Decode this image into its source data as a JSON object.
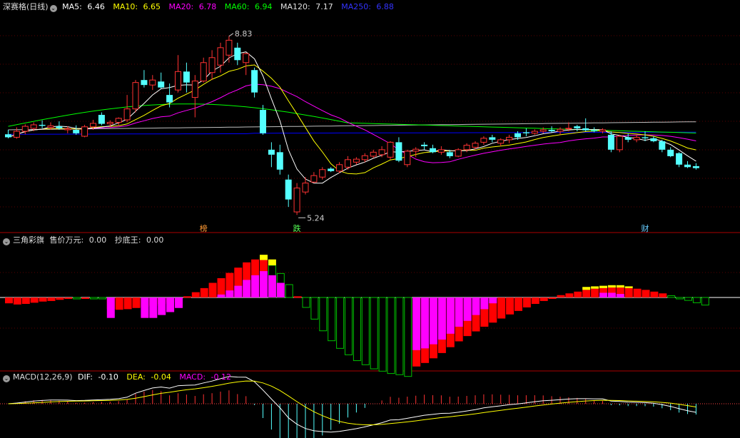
{
  "colors": {
    "up": "#ff3232",
    "down": "#54ffff",
    "ma5": "#ffffff",
    "ma10": "#ffff00",
    "ma20": "#ff00ff",
    "ma60": "#00ff00",
    "ma120": "#c0c0c0",
    "ma250": "#0000ff",
    "magenta": "#ff00ff",
    "yellow": "#ffff00",
    "red": "#ff0000",
    "green": "#00c000",
    "divider": "#aa0000"
  },
  "main_panel": {
    "title": "深赛格(日线)",
    "icon": "chevron-down-icon",
    "ma": [
      {
        "label": "MA5:",
        "value": "6.46"
      },
      {
        "label": "MA10:",
        "value": "6.65"
      },
      {
        "label": "MA20:",
        "value": "6.78"
      },
      {
        "label": "MA60:",
        "value": "6.94"
      },
      {
        "label": "MA120:",
        "value": "7.17"
      },
      {
        "label": "MA250:",
        "value": "6.88"
      }
    ],
    "high_label": "8.83",
    "low_label": "5.24",
    "markers": [
      "榜",
      "跌",
      "财"
    ]
  },
  "sub1_panel": {
    "title": "三角彩旗",
    "legend": [
      {
        "label": "售价万元:",
        "value": "0.00"
      },
      {
        "label": "抄底王:",
        "value": "0.00"
      }
    ]
  },
  "sub2_panel": {
    "title": "MACD(12,26,9)",
    "legend": [
      {
        "label": "DIF:",
        "value": "-0.10"
      },
      {
        "label": "DEA:",
        "value": "-0.04"
      },
      {
        "label": "MACD:",
        "value": "-0.12"
      }
    ]
  },
  "chart_data": [
    {
      "type": "candlestick",
      "title": "深赛格(日线)",
      "ylim": [
        5.0,
        9.3
      ],
      "candles": [
        {
          "o": 6.86,
          "h": 6.95,
          "l": 6.78,
          "c": 6.8
        },
        {
          "o": 6.8,
          "h": 7.0,
          "l": 6.77,
          "c": 6.92
        },
        {
          "o": 6.92,
          "h": 7.06,
          "l": 6.86,
          "c": 7.02
        },
        {
          "o": 6.98,
          "h": 7.1,
          "l": 6.92,
          "c": 7.05
        },
        {
          "o": 7.05,
          "h": 7.14,
          "l": 6.98,
          "c": 7.03
        },
        {
          "o": 7.0,
          "h": 7.1,
          "l": 6.95,
          "c": 7.03
        },
        {
          "o": 7.02,
          "h": 7.12,
          "l": 6.95,
          "c": 6.98
        },
        {
          "o": 6.95,
          "h": 7.02,
          "l": 6.88,
          "c": 6.97
        },
        {
          "o": 6.95,
          "h": 7.04,
          "l": 6.85,
          "c": 6.88
        },
        {
          "o": 6.82,
          "h": 7.05,
          "l": 6.8,
          "c": 7.01
        },
        {
          "o": 7.01,
          "h": 7.15,
          "l": 6.95,
          "c": 7.08
        },
        {
          "o": 7.25,
          "h": 7.3,
          "l": 7.04,
          "c": 7.07
        },
        {
          "o": 7.07,
          "h": 7.14,
          "l": 7.0,
          "c": 7.1
        },
        {
          "o": 7.1,
          "h": 7.2,
          "l": 7.03,
          "c": 7.18
        },
        {
          "o": 7.15,
          "h": 7.65,
          "l": 7.1,
          "c": 7.37
        },
        {
          "o": 7.37,
          "h": 7.95,
          "l": 7.3,
          "c": 7.9
        },
        {
          "o": 7.95,
          "h": 8.15,
          "l": 7.8,
          "c": 7.85
        },
        {
          "o": 7.85,
          "h": 8.05,
          "l": 7.75,
          "c": 7.95
        },
        {
          "o": 7.92,
          "h": 8.1,
          "l": 7.78,
          "c": 7.8
        },
        {
          "o": 7.65,
          "h": 7.88,
          "l": 7.4,
          "c": 7.5
        },
        {
          "o": 7.75,
          "h": 8.45,
          "l": 7.7,
          "c": 8.12
        },
        {
          "o": 8.12,
          "h": 8.3,
          "l": 7.7,
          "c": 7.9
        },
        {
          "o": 7.6,
          "h": 8.05,
          "l": 7.2,
          "c": 7.93
        },
        {
          "o": 7.93,
          "h": 8.4,
          "l": 7.9,
          "c": 8.3
        },
        {
          "o": 8.1,
          "h": 8.55,
          "l": 7.95,
          "c": 8.4
        },
        {
          "o": 8.25,
          "h": 8.7,
          "l": 8.1,
          "c": 8.6
        },
        {
          "o": 8.45,
          "h": 8.83,
          "l": 8.3,
          "c": 8.75
        },
        {
          "o": 8.6,
          "h": 8.7,
          "l": 8.25,
          "c": 8.35
        },
        {
          "o": 8.3,
          "h": 8.5,
          "l": 8.05,
          "c": 8.48
        },
        {
          "o": 8.15,
          "h": 8.2,
          "l": 7.6,
          "c": 7.7
        },
        {
          "o": 7.35,
          "h": 7.45,
          "l": 6.85,
          "c": 6.88
        },
        {
          "o": 6.55,
          "h": 6.7,
          "l": 6.2,
          "c": 6.45
        },
        {
          "o": 6.5,
          "h": 6.65,
          "l": 6.05,
          "c": 6.15
        },
        {
          "o": 5.95,
          "h": 6.05,
          "l": 5.4,
          "c": 5.55
        },
        {
          "o": 5.3,
          "h": 5.88,
          "l": 5.24,
          "c": 5.78
        },
        {
          "o": 5.7,
          "h": 6.0,
          "l": 5.65,
          "c": 5.88
        },
        {
          "o": 5.9,
          "h": 6.1,
          "l": 5.88,
          "c": 6.03
        },
        {
          "o": 6.0,
          "h": 6.2,
          "l": 5.95,
          "c": 6.15
        },
        {
          "o": 6.17,
          "h": 6.2,
          "l": 6.1,
          "c": 6.12
        },
        {
          "o": 6.12,
          "h": 6.3,
          "l": 6.08,
          "c": 6.25
        },
        {
          "o": 6.2,
          "h": 6.42,
          "l": 6.15,
          "c": 6.35
        },
        {
          "o": 6.3,
          "h": 6.4,
          "l": 6.25,
          "c": 6.36
        },
        {
          "o": 6.35,
          "h": 6.48,
          "l": 6.3,
          "c": 6.43
        },
        {
          "o": 6.42,
          "h": 6.55,
          "l": 6.38,
          "c": 6.5
        },
        {
          "o": 6.45,
          "h": 6.62,
          "l": 6.4,
          "c": 6.55
        },
        {
          "o": 6.4,
          "h": 6.72,
          "l": 6.35,
          "c": 6.7
        },
        {
          "o": 6.7,
          "h": 6.8,
          "l": 6.3,
          "c": 6.33
        },
        {
          "o": 6.25,
          "h": 6.55,
          "l": 6.2,
          "c": 6.52
        },
        {
          "o": 6.52,
          "h": 6.6,
          "l": 6.4,
          "c": 6.56
        },
        {
          "o": 6.65,
          "h": 6.7,
          "l": 6.55,
          "c": 6.62
        },
        {
          "o": 6.58,
          "h": 6.65,
          "l": 6.48,
          "c": 6.5
        },
        {
          "o": 6.5,
          "h": 6.62,
          "l": 6.45,
          "c": 6.55
        },
        {
          "o": 6.5,
          "h": 6.55,
          "l": 6.38,
          "c": 6.42
        },
        {
          "o": 6.42,
          "h": 6.58,
          "l": 6.4,
          "c": 6.55
        },
        {
          "o": 6.55,
          "h": 6.68,
          "l": 6.5,
          "c": 6.64
        },
        {
          "o": 6.6,
          "h": 6.72,
          "l": 6.55,
          "c": 6.68
        },
        {
          "o": 6.7,
          "h": 6.82,
          "l": 6.65,
          "c": 6.78
        },
        {
          "o": 6.8,
          "h": 6.85,
          "l": 6.7,
          "c": 6.75
        },
        {
          "o": 6.68,
          "h": 6.78,
          "l": 6.62,
          "c": 6.75
        },
        {
          "o": 6.75,
          "h": 6.85,
          "l": 6.68,
          "c": 6.8
        },
        {
          "o": 6.88,
          "h": 6.92,
          "l": 6.75,
          "c": 6.8
        },
        {
          "o": 6.9,
          "h": 6.98,
          "l": 6.82,
          "c": 6.88
        },
        {
          "o": 6.88,
          "h": 6.96,
          "l": 6.85,
          "c": 6.92
        },
        {
          "o": 6.92,
          "h": 7.0,
          "l": 6.88,
          "c": 6.95
        },
        {
          "o": 6.95,
          "h": 7.02,
          "l": 6.9,
          "c": 6.92
        },
        {
          "o": 6.92,
          "h": 7.0,
          "l": 6.85,
          "c": 6.96
        },
        {
          "o": 6.98,
          "h": 7.1,
          "l": 6.92,
          "c": 6.98
        },
        {
          "o": 7.02,
          "h": 7.05,
          "l": 6.92,
          "c": 6.98
        },
        {
          "o": 6.98,
          "h": 7.18,
          "l": 6.92,
          "c": 6.94
        },
        {
          "o": 6.94,
          "h": 7.0,
          "l": 6.9,
          "c": 6.92
        },
        {
          "o": 6.92,
          "h": 6.98,
          "l": 6.88,
          "c": 6.95
        },
        {
          "o": 6.85,
          "h": 6.92,
          "l": 6.5,
          "c": 6.55
        },
        {
          "o": 6.55,
          "h": 6.85,
          "l": 6.5,
          "c": 6.82
        },
        {
          "o": 6.8,
          "h": 6.88,
          "l": 6.7,
          "c": 6.75
        },
        {
          "o": 6.75,
          "h": 6.85,
          "l": 6.7,
          "c": 6.8
        },
        {
          "o": 6.8,
          "h": 6.92,
          "l": 6.72,
          "c": 6.78
        },
        {
          "o": 6.78,
          "h": 6.82,
          "l": 6.7,
          "c": 6.72
        },
        {
          "o": 6.72,
          "h": 6.75,
          "l": 6.5,
          "c": 6.55
        },
        {
          "o": 6.55,
          "h": 6.6,
          "l": 6.4,
          "c": 6.42
        },
        {
          "o": 6.48,
          "h": 6.5,
          "l": 6.2,
          "c": 6.25
        },
        {
          "o": 6.25,
          "h": 6.32,
          "l": 6.18,
          "c": 6.2
        },
        {
          "o": 6.22,
          "h": 6.28,
          "l": 6.15,
          "c": 6.18
        }
      ],
      "ma": {
        "MA5": [],
        "MA10": [],
        "MA20": [],
        "MA60": [],
        "MA120": [],
        "MA250": []
      }
    },
    {
      "type": "bar",
      "title": "三角彩旗",
      "ylim": [
        -1.4,
        1.0
      ],
      "values": [
        -0.1,
        -0.12,
        -0.11,
        -0.09,
        -0.07,
        -0.06,
        -0.04,
        -0.02,
        -0.01,
        0.0,
        -0.01,
        -0.01,
        -0.2,
        -0.21,
        -0.2,
        -0.18,
        -0.16,
        -0.14,
        -0.11,
        -0.08,
        -0.04,
        0.02,
        0.09,
        0.16,
        0.25,
        0.33,
        0.42,
        0.51,
        0.6,
        0.65,
        0.64,
        0.55,
        0.41,
        0.22,
        0.02,
        -0.17,
        -0.37,
        -0.57,
        -0.74,
        -0.87,
        -0.98,
        -1.08,
        -1.15,
        -1.22,
        -1.26,
        -1.3,
        -1.32,
        -1.35,
        -1.18,
        -1.12,
        -1.04,
        -0.95,
        -0.85,
        -0.75,
        -0.66,
        -0.58,
        -0.5,
        -0.43,
        -0.36,
        -0.29,
        -0.23,
        -0.17,
        -0.11,
        -0.06,
        0.0,
        0.04,
        0.07,
        0.1,
        0.13,
        0.15,
        0.16,
        0.17,
        0.17,
        0.16,
        0.15,
        0.13,
        0.1,
        0.07,
        0.03,
        -0.01,
        -0.05,
        -0.09,
        -0.13
      ],
      "overlay": [
        0,
        0,
        0,
        0,
        0,
        0,
        0,
        0,
        0,
        0,
        0,
        0,
        -0.35,
        0,
        0,
        0,
        -0.35,
        -0.35,
        -0.3,
        -0.25,
        -0.18,
        0,
        0,
        0,
        0,
        0.05,
        0.12,
        0.2,
        0.3,
        0.38,
        0.45,
        0.38,
        0.25,
        0,
        0,
        0,
        0,
        0,
        0,
        0,
        0,
        0,
        0,
        0,
        0,
        0,
        0,
        0,
        -0.9,
        -0.87,
        -0.8,
        -0.72,
        -0.62,
        -0.5,
        -0.4,
        -0.3,
        -0.2,
        -0.1,
        0,
        0,
        0,
        0,
        0,
        0,
        0,
        0,
        0,
        0,
        0,
        0,
        0.08,
        0.08,
        0.06,
        0,
        0,
        0,
        0,
        0,
        0,
        0,
        0,
        0,
        0
      ],
      "gold": [
        0,
        0,
        0,
        0,
        0,
        0,
        0,
        0,
        0,
        0,
        0,
        0,
        0,
        0,
        0,
        0,
        0,
        0,
        0,
        0,
        0,
        0,
        0,
        0,
        0,
        0,
        0,
        0,
        0,
        0,
        0.09,
        0.1,
        0,
        0,
        0,
        0,
        0,
        0,
        0,
        0,
        0,
        0,
        0,
        0,
        0,
        0,
        0,
        0,
        0,
        0,
        0,
        0,
        0,
        0,
        0,
        0,
        0,
        0,
        0,
        0,
        0,
        0.04,
        0,
        0,
        0,
        0,
        0,
        0,
        0.05,
        0.04,
        0.04,
        0.04,
        0.04,
        0.03,
        0,
        0,
        0,
        0,
        0,
        0,
        0,
        0,
        0
      ]
    },
    {
      "type": "bar",
      "title": "MACD(12,26,9)",
      "ylim": [
        -0.6,
        0.35
      ],
      "dif": [],
      "dea": [],
      "macd": []
    }
  ]
}
